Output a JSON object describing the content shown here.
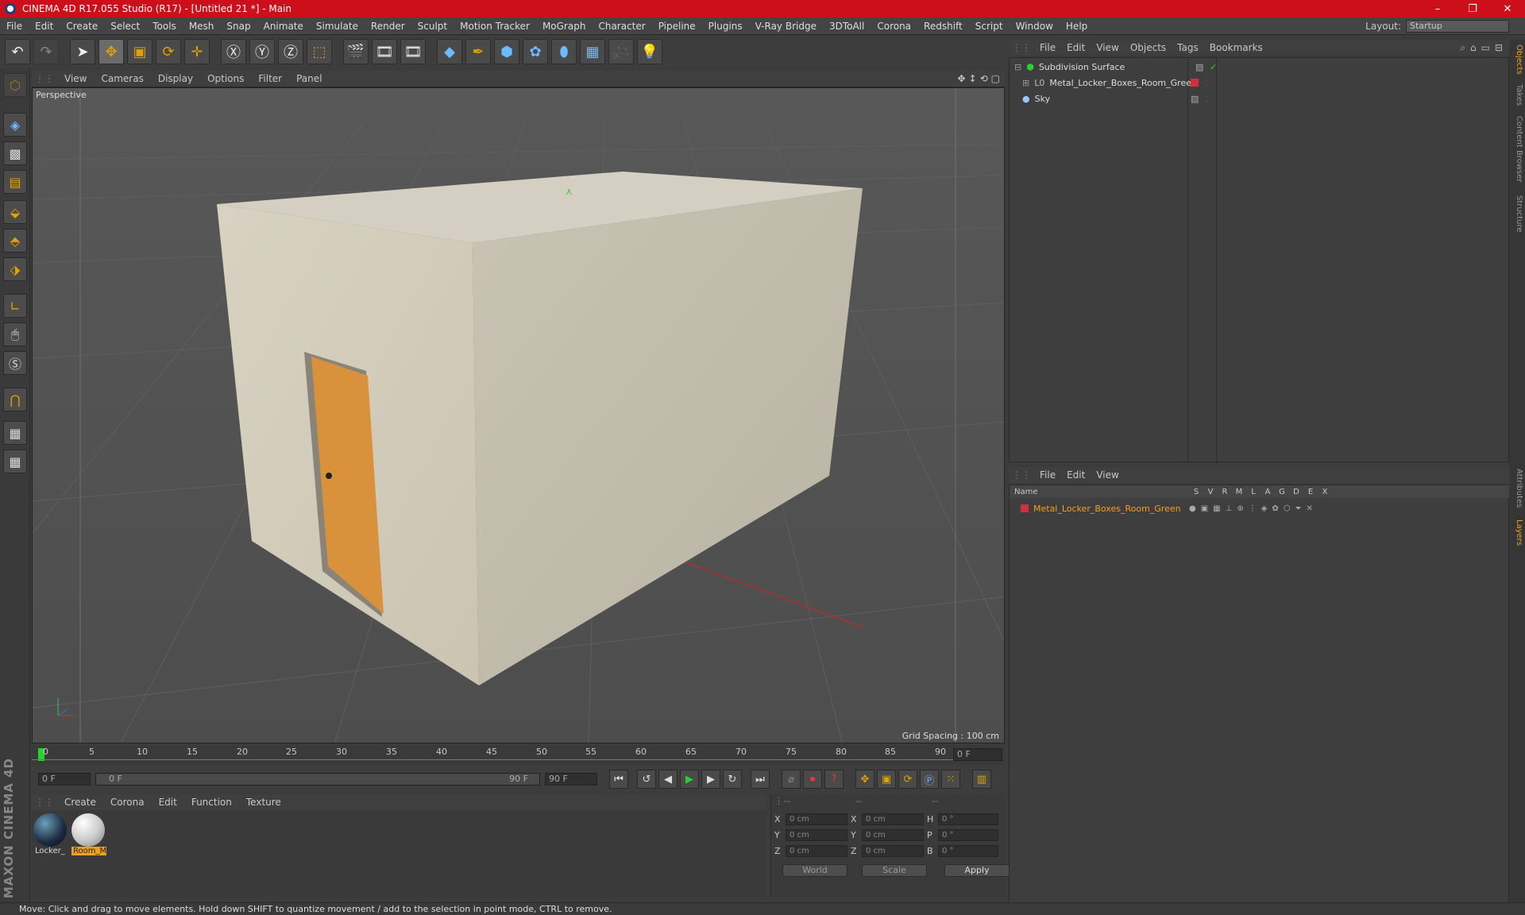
{
  "window": {
    "title": "CINEMA 4D R17.055 Studio (R17) - [Untitled 21 *] - Main",
    "controls": [
      "–",
      "❐",
      "✕"
    ]
  },
  "menubar": {
    "items": [
      "File",
      "Edit",
      "Create",
      "Select",
      "Tools",
      "Mesh",
      "Snap",
      "Animate",
      "Simulate",
      "Render",
      "Sculpt",
      "Motion Tracker",
      "MoGraph",
      "Character",
      "Pipeline",
      "Plugins",
      "V-Ray Bridge",
      "3DToAll",
      "Corona",
      "Redshift",
      "Script",
      "Window",
      "Help"
    ],
    "layout_label": "Layout:",
    "layout_value": "Startup"
  },
  "viewport": {
    "menu": [
      "View",
      "Cameras",
      "Display",
      "Options",
      "Filter",
      "Panel"
    ],
    "camera_label": "Perspective",
    "grid_spacing": "Grid Spacing : 100 cm"
  },
  "timeline": {
    "ticks": [
      "0",
      "5",
      "10",
      "15",
      "20",
      "25",
      "30",
      "35",
      "40",
      "45",
      "50",
      "55",
      "60",
      "65",
      "70",
      "75",
      "80",
      "85",
      "90"
    ],
    "current_frame": "0 F",
    "start_frame": "0 F",
    "range_start": "0 F",
    "range_end": "90 F",
    "end_frame": "90 F"
  },
  "material_manager": {
    "menu": [
      "Create",
      "Corona",
      "Edit",
      "Function",
      "Texture"
    ],
    "materials": [
      {
        "name": "Locker_",
        "selected": false
      },
      {
        "name": "Room_M",
        "selected": true
      }
    ]
  },
  "coordinates": {
    "headers": [
      "--",
      "--",
      "--"
    ],
    "rows": [
      {
        "a": "X",
        "av": "0 cm",
        "b": "X",
        "bv": "0 cm",
        "c": "H",
        "cv": "0 °"
      },
      {
        "a": "Y",
        "av": "0 cm",
        "b": "Y",
        "bv": "0 cm",
        "c": "P",
        "cv": "0 °"
      },
      {
        "a": "Z",
        "av": "0 cm",
        "b": "Z",
        "bv": "0 cm",
        "c": "B",
        "cv": "0 °"
      }
    ],
    "world": "World",
    "scale": "Scale",
    "apply": "Apply"
  },
  "objects_panel": {
    "menu": [
      "File",
      "Edit",
      "View",
      "Objects",
      "Tags",
      "Bookmarks"
    ],
    "objects": [
      "Subdivision Surface",
      "Metal_Locker_Boxes_Room_Green",
      "Sky"
    ]
  },
  "layers_panel": {
    "menu": [
      "File",
      "Edit",
      "View"
    ],
    "columns": [
      "Name",
      "S",
      "V",
      "R",
      "M",
      "L",
      "A",
      "G",
      "D",
      "E",
      "X"
    ],
    "layers": [
      "Metal_Locker_Boxes_Room_Green"
    ]
  },
  "side_tabs": [
    "Objects",
    "Takes",
    "Content Browser",
    "Structure",
    "Attributes",
    "Layers"
  ],
  "branding": "MAXON CINEMA 4D",
  "status": "Move: Click and drag to move elements. Hold down SHIFT to quantize movement / add to the selection in point mode, CTRL to remove.",
  "colors": {
    "title_red": "#cc0f1a",
    "accent_orange": "#e5a100",
    "selection_orange": "#f0a020",
    "layer_red": "#d0303a"
  }
}
